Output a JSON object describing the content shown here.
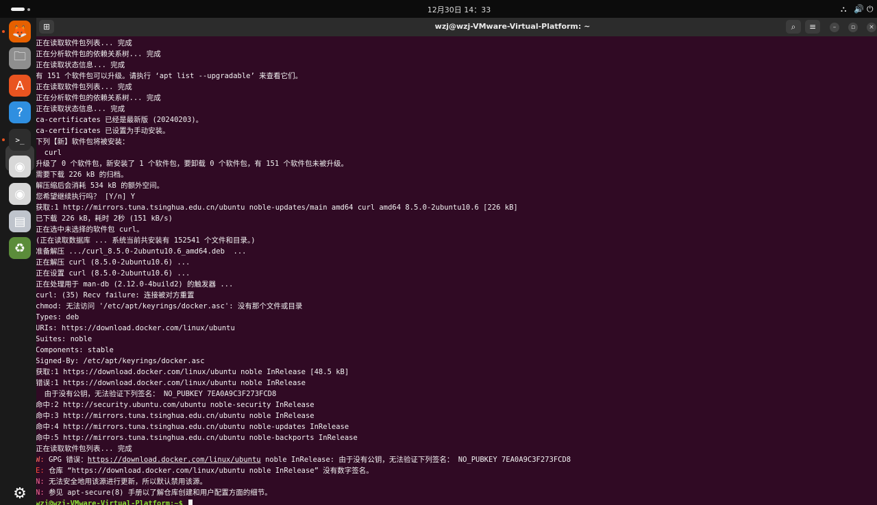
{
  "system": {
    "clock": "12月30日  14：33",
    "tray": {
      "network_icon": "network-icon",
      "volume_icon": "volume-icon",
      "power_icon": "power-icon"
    }
  },
  "dock": {
    "apps": [
      {
        "name": "firefox",
        "icon": "firefox-icon",
        "color": "#e66000",
        "glyph": "🦊"
      },
      {
        "name": "files",
        "icon": "files-icon",
        "color": "#8e8e8e",
        "glyph": "🗀"
      },
      {
        "name": "app-center",
        "icon": "app-center-icon",
        "color": "#e95420",
        "glyph": "A"
      },
      {
        "name": "help",
        "icon": "help-icon",
        "color": "#2f8fe0",
        "glyph": "?"
      },
      {
        "name": "terminal",
        "icon": "terminal-icon",
        "color": "#2d2d2d",
        "glyph": ">_"
      },
      {
        "name": "disc-1",
        "icon": "disc-icon",
        "color": "#d8d8d8",
        "glyph": "◉"
      },
      {
        "name": "disc-2",
        "icon": "disc-icon",
        "color": "#d8d8d8",
        "glyph": "◉"
      },
      {
        "name": "floppy",
        "icon": "save-disk-icon",
        "color": "#bfc4cc",
        "glyph": "▤"
      },
      {
        "name": "trash",
        "icon": "trash-icon",
        "color": "#5b8c3a",
        "glyph": "♻"
      }
    ],
    "show_apps_icon": "ubuntu-logo-icon"
  },
  "terminal": {
    "title": "wzj@wzj-VMware-Virtual-Platform: ~",
    "lines": [
      {
        "text": "正在读取软件包列表... 完成"
      },
      {
        "text": "正在分析软件包的依赖关系树... 完成"
      },
      {
        "text": "正在读取状态信息... 完成"
      },
      {
        "text": "有 151 个软件包可以升级。请执行 ‘apt list --upgradable’ 来查看它们。"
      },
      {
        "text": "正在读取软件包列表... 完成"
      },
      {
        "text": "正在分析软件包的依赖关系树... 完成"
      },
      {
        "text": "正在读取状态信息... 完成"
      },
      {
        "text": "ca-certificates 已经是最新版 (20240203)。"
      },
      {
        "text": "ca-certificates 已设置为手动安装。"
      },
      {
        "text": "下列【新】软件包将被安装："
      },
      {
        "text": "  curl"
      },
      {
        "text": "升级了 0 个软件包，新安装了 1 个软件包，要卸载 0 个软件包，有 151 个软件包未被升级。"
      },
      {
        "text": "需要下载 226 kB 的归档。"
      },
      {
        "text": "解压缩后会消耗 534 kB 的额外空间。"
      },
      {
        "text": "您希望继续执行吗？ [Y/n] Y"
      },
      {
        "text": "获取:1 http://mirrors.tuna.tsinghua.edu.cn/ubuntu noble-updates/main amd64 curl amd64 8.5.0-2ubuntu10.6 [226 kB]"
      },
      {
        "text": "已下载 226 kB，耗时 2秒 (151 kB/s)"
      },
      {
        "text": "正在选中未选择的软件包 curl。"
      },
      {
        "text": "(正在读取数据库 ... 系统当前共安装有 152541 个文件和目录。)"
      },
      {
        "text": "准备解压 .../curl_8.5.0-2ubuntu10.6_amd64.deb  ..."
      },
      {
        "text": "正在解压 curl (8.5.0-2ubuntu10.6) ..."
      },
      {
        "text": "正在设置 curl (8.5.0-2ubuntu10.6) ..."
      },
      {
        "text": "正在处理用于 man-db (2.12.0-4build2) 的触发器 ..."
      },
      {
        "text": "curl: (35) Recv failure: 连接被对方重置"
      },
      {
        "text": "chmod: 无法访问 '/etc/apt/keyrings/docker.asc': 没有那个文件或目录"
      },
      {
        "text": "Types: deb"
      },
      {
        "text": "URIs: https://download.docker.com/linux/ubuntu"
      },
      {
        "text": "Suites: noble"
      },
      {
        "text": "Components: stable"
      },
      {
        "text": "Signed-By: /etc/apt/keyrings/docker.asc"
      },
      {
        "text": "获取:1 https://download.docker.com/linux/ubuntu noble InRelease [48.5 kB]"
      },
      {
        "text": "错误:1 https://download.docker.com/linux/ubuntu noble InRelease"
      },
      {
        "text": "  由于没有公钥，无法验证下列签名： NO_PUBKEY 7EA0A9C3F273FCD8"
      },
      {
        "text": "命中:2 http://security.ubuntu.com/ubuntu noble-security InRelease"
      },
      {
        "text": "命中:3 http://mirrors.tuna.tsinghua.edu.cn/ubuntu noble InRelease"
      },
      {
        "text": "命中:4 http://mirrors.tuna.tsinghua.edu.cn/ubuntu noble-updates InRelease"
      },
      {
        "text": "命中:5 http://mirrors.tuna.tsinghua.edu.cn/ubuntu noble-backports InRelease"
      },
      {
        "text": "正在读取软件包列表... 完成"
      },
      {
        "prefix": "W: ",
        "prefix_kind": "w",
        "pre": "GPG 错误：",
        "link": "https://download.docker.com/linux/ubuntu",
        "text": " noble InRelease: 由于没有公钥，无法验证下列签名： NO_PUBKEY 7EA0A9C3F273FCD8"
      },
      {
        "prefix": "E: ",
        "prefix_kind": "e",
        "text": "仓库 “https://download.docker.com/linux/ubuntu noble InRelease” 没有数字签名。"
      },
      {
        "prefix": "N: ",
        "prefix_kind": "n",
        "text": "无法安全地用该源进行更新，所以默认禁用该源。"
      },
      {
        "prefix": "N: ",
        "prefix_kind": "n",
        "text": "参见 apt-secure(8) 手册以了解仓库创建和用户配置方面的细节。"
      }
    ],
    "prompt": "wzj@wzj-VMware-Virtual-Platform:~$ "
  }
}
